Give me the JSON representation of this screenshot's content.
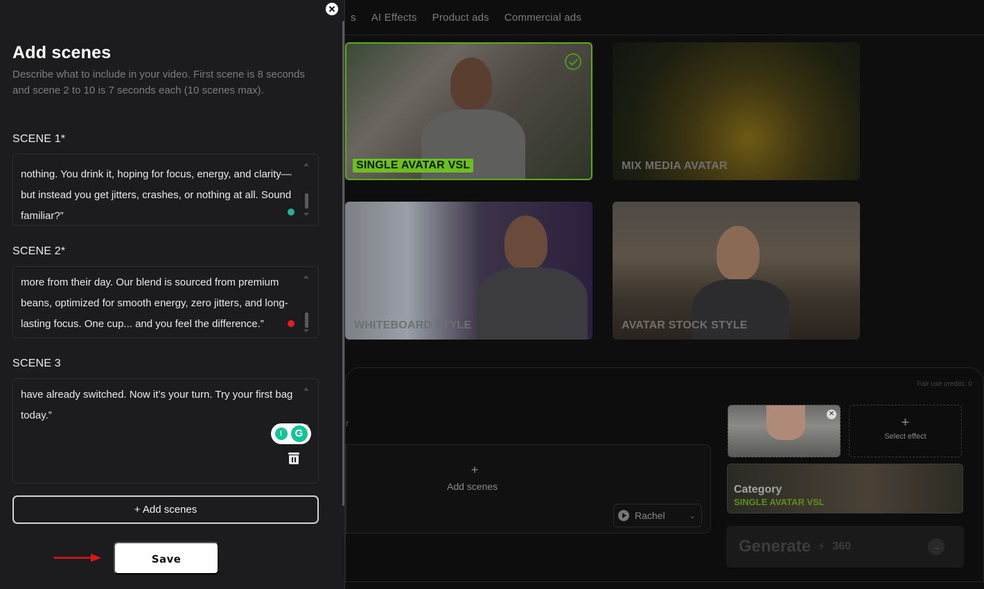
{
  "background": {
    "tabs": [
      "s",
      "AI Effects",
      "Product ads",
      "Commercial ads"
    ],
    "cards": [
      {
        "label": "SINGLE AVATAR VSL",
        "selected": true
      },
      {
        "label": "MIX MEDIA AVATAR",
        "selected": false
      },
      {
        "label": "WHITEBOARD STYLE",
        "selected": false
      },
      {
        "label": "AVATAR STOCK STYLE",
        "selected": false
      }
    ],
    "fair_use": "Fair use credits: 0",
    "stray_char": "r",
    "add_scenes_plus": "+",
    "add_scenes_label": "Add scenes",
    "voice": "Rachel",
    "select_effect_plus": "+",
    "select_effect_label": "Select effect",
    "category_key": "Category",
    "category_value": "SINGLE AVATAR VSL",
    "generate_label": "Generate",
    "generate_cost": "360",
    "accent_color": "#6cbf1f"
  },
  "panel": {
    "title": "Add scenes",
    "description": "Describe what to include in your video. First scene is 8 seconds and scene 2 to 10 is 7 seconds each (10 scenes max).",
    "scenes": [
      {
        "title": "SCENE 1*",
        "text": "nothing. You drink it, hoping for focus, energy, and clarity—but instead you get jitters, crashes, or nothing at all. Sound familiar?”",
        "status_color": "#26b39a"
      },
      {
        "title": "SCENE 2*",
        "text": "more from their day. Our blend is sourced from premium beans, optimized for smooth energy, zero jitters, and long-lasting focus. One cup... and you feel the difference.”",
        "status_color": "#e0201c"
      },
      {
        "title": "SCENE 3",
        "text": "have already switched. Now it’s your turn. Try your first bag today.”"
      }
    ],
    "add_scenes_button": "+ Add scenes",
    "save_button": "Save",
    "grammarly_icon": "grammarly-icon",
    "close_icon": "close-icon"
  }
}
